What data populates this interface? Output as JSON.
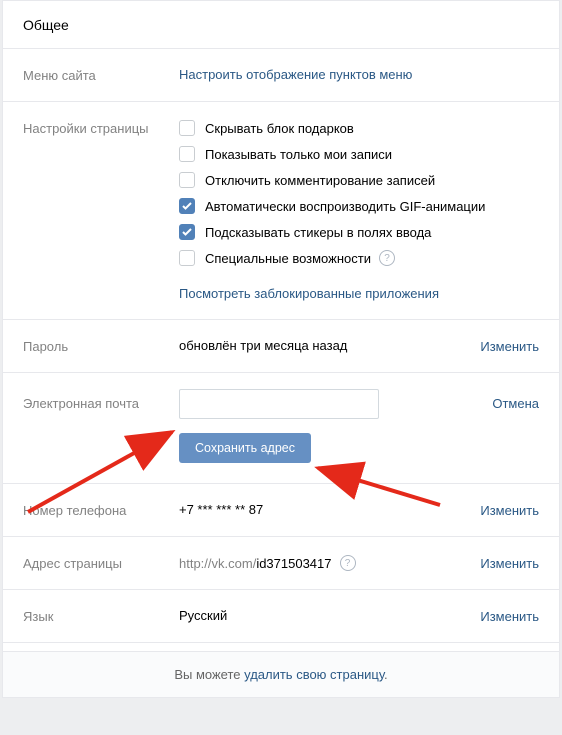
{
  "header": {
    "title": "Общее"
  },
  "menu": {
    "label": "Меню сайта",
    "link": "Настроить отображение пунктов меню"
  },
  "page_settings": {
    "label": "Настройки страницы",
    "options": [
      {
        "text": "Скрывать блок подарков",
        "checked": false
      },
      {
        "text": "Показывать только мои записи",
        "checked": false
      },
      {
        "text": "Отключить комментирование записей",
        "checked": false
      },
      {
        "text": "Автоматически воспроизводить GIF-анимации",
        "checked": true
      },
      {
        "text": "Подсказывать стикеры в полях ввода",
        "checked": true
      },
      {
        "text": "Специальные возможности",
        "checked": false,
        "help": true
      }
    ],
    "blocked_link": "Посмотреть заблокированные приложения"
  },
  "password": {
    "label": "Пароль",
    "value": "обновлён три месяца назад",
    "action": "Изменить"
  },
  "email": {
    "label": "Электронная почта",
    "value": "",
    "save_btn": "Сохранить адрес",
    "action": "Отмена"
  },
  "phone": {
    "label": "Номер телефона",
    "value": "+7 *** *** ** 87",
    "action": "Изменить"
  },
  "page_url": {
    "label": "Адрес страницы",
    "prefix": "http://vk.com/",
    "id": "id371503417",
    "action": "Изменить"
  },
  "language": {
    "label": "Язык",
    "value": "Русский",
    "action": "Изменить"
  },
  "footer": {
    "prefix": "Вы можете ",
    "link": "удалить свою страницу",
    "suffix": "."
  }
}
